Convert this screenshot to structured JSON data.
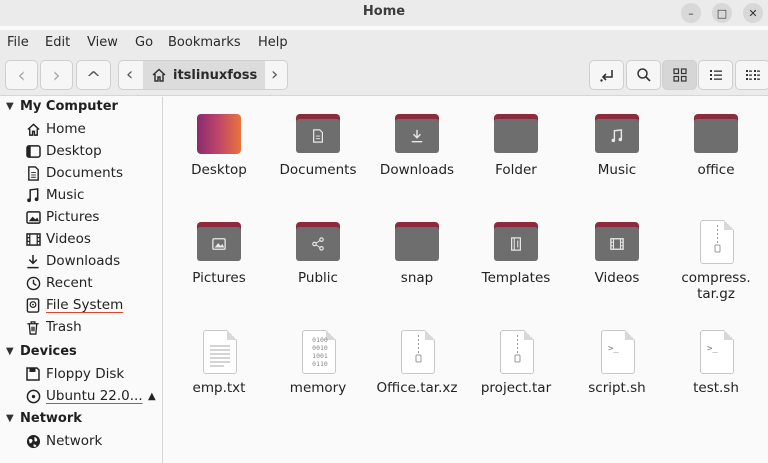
{
  "window": {
    "title": "Home",
    "min_glyph": "–",
    "max_glyph": "□",
    "close_glyph": "✕"
  },
  "menu": [
    "File",
    "Edit",
    "View",
    "Go",
    "Bookmarks",
    "Help"
  ],
  "toolbar": {
    "back": "‹",
    "forward": "›",
    "up": "^",
    "path_prev": "‹",
    "path_next": "›",
    "path_current": "itslinuxfoss"
  },
  "sidebar": {
    "sections": [
      {
        "title": "My Computer",
        "items": [
          {
            "label": "Home",
            "icon": "home-icon"
          },
          {
            "label": "Desktop",
            "icon": "desktop-icon"
          },
          {
            "label": "Documents",
            "icon": "documents-icon"
          },
          {
            "label": "Music",
            "icon": "music-icon"
          },
          {
            "label": "Pictures",
            "icon": "pictures-icon"
          },
          {
            "label": "Videos",
            "icon": "videos-icon"
          },
          {
            "label": "Downloads",
            "icon": "downloads-icon"
          },
          {
            "label": "Recent",
            "icon": "recent-icon"
          },
          {
            "label": "File System",
            "icon": "filesystem-icon"
          },
          {
            "label": "Trash",
            "icon": "trash-icon"
          }
        ]
      },
      {
        "title": "Devices",
        "items": [
          {
            "label": "Floppy Disk",
            "icon": "floppy-icon"
          },
          {
            "label": "Ubuntu 22.0...",
            "icon": "disk-icon"
          }
        ]
      },
      {
        "title": "Network",
        "items": [
          {
            "label": "Network",
            "icon": "network-icon"
          }
        ]
      }
    ],
    "eject_glyph": "▲"
  },
  "files": [
    {
      "name": "Desktop",
      "type": "desktop-folder"
    },
    {
      "name": "Documents",
      "type": "folder",
      "emblem": "document"
    },
    {
      "name": "Downloads",
      "type": "folder",
      "emblem": "download"
    },
    {
      "name": "Folder",
      "type": "folder"
    },
    {
      "name": "Music",
      "type": "folder",
      "emblem": "music"
    },
    {
      "name": "office",
      "type": "folder"
    },
    {
      "name": "Pictures",
      "type": "folder",
      "emblem": "picture"
    },
    {
      "name": "Public",
      "type": "folder",
      "emblem": "share"
    },
    {
      "name": "snap",
      "type": "folder"
    },
    {
      "name": "Templates",
      "type": "folder",
      "emblem": "template"
    },
    {
      "name": "Videos",
      "type": "folder",
      "emblem": "video"
    },
    {
      "name": "compress.\ntar.gz",
      "type": "archive"
    },
    {
      "name": "emp.txt",
      "type": "text"
    },
    {
      "name": "memory",
      "type": "binary"
    },
    {
      "name": "Office.tar.xz",
      "type": "archive"
    },
    {
      "name": "project.tar",
      "type": "archive"
    },
    {
      "name": "script.sh",
      "type": "script"
    },
    {
      "name": "test.sh",
      "type": "script"
    }
  ],
  "glyphs": {
    "binary": [
      "0100",
      "0010",
      "1001",
      "0110"
    ],
    "prompt": ">_"
  }
}
